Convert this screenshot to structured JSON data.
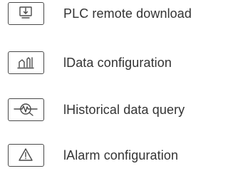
{
  "menu": {
    "items": [
      {
        "label": "PLC remote download",
        "icon": "monitor-download-icon"
      },
      {
        "label": "lData configuration",
        "icon": "bar-chart-icon"
      },
      {
        "label": "lHistorical data query",
        "icon": "waveform-search-icon"
      },
      {
        "label": "lAlarm configuration",
        "icon": "warning-triangle-icon"
      }
    ]
  },
  "colors": {
    "text": "#333333",
    "icon_stroke": "#4a4a4a",
    "background": "#ffffff"
  }
}
